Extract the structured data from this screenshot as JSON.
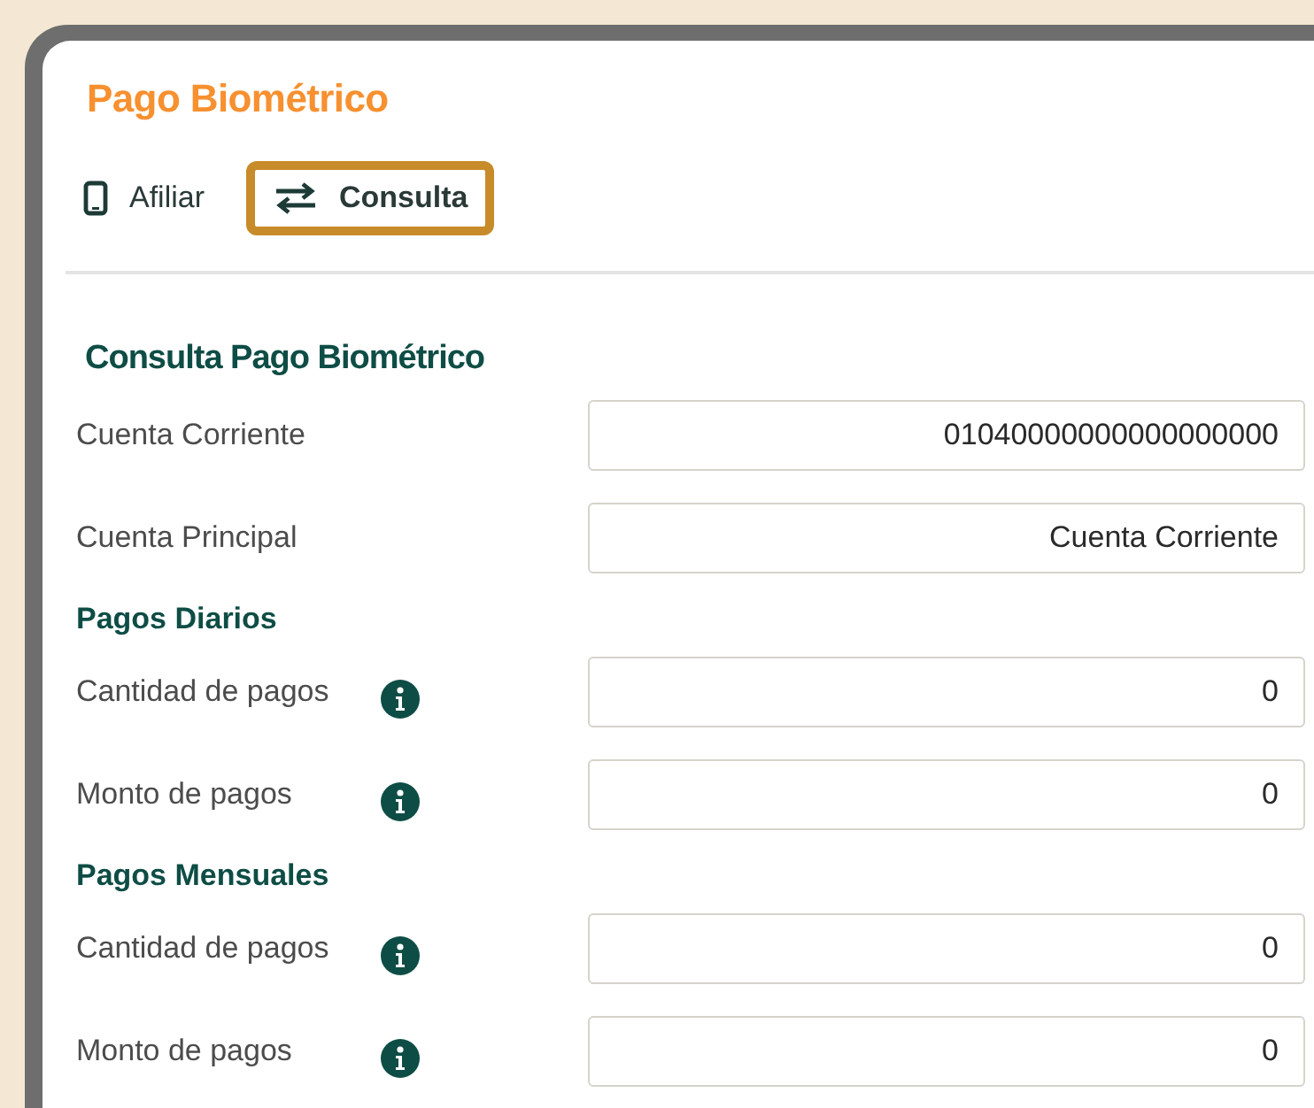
{
  "title": "Pago Biométrico",
  "tabs": [
    {
      "label": "Afiliar",
      "kind": "phone",
      "selected": false
    },
    {
      "label": "Consulta",
      "kind": "swap",
      "selected": true
    }
  ],
  "form": {
    "heading": "Consulta Pago Biométrico",
    "sections": [
      {
        "rows": [
          {
            "label": "Cuenta Corriente",
            "info": false,
            "value": "01040000000000000000"
          },
          {
            "label": "Cuenta Principal",
            "info": false,
            "value": "Cuenta Corriente"
          }
        ]
      },
      {
        "heading": "Pagos Diarios",
        "rows": [
          {
            "label": "Cantidad de pagos",
            "info": true,
            "value": "0"
          },
          {
            "label": "Monto de pagos",
            "info": true,
            "value": "0"
          }
        ]
      },
      {
        "heading": "Pagos Mensuales",
        "rows": [
          {
            "label": "Cantidad de pagos",
            "info": true,
            "value": "0"
          },
          {
            "label": "Monto de pagos",
            "info": true,
            "value": "0"
          }
        ]
      }
    ]
  }
}
